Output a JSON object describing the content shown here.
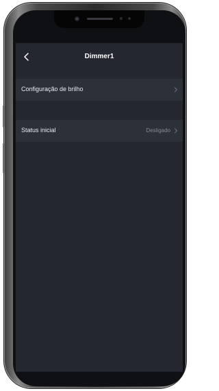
{
  "header": {
    "title": "Dimmer1",
    "back_icon": "chevron-left-icon"
  },
  "settings": {
    "brightness_label": "Configuração de brilho",
    "initial_status_label": "Status inicial",
    "initial_status_value": "Desligado",
    "chevron_icon": "chevron-right-icon"
  },
  "colors": {
    "screen_background": "#24272f",
    "row_background": "#2c3039",
    "primary_text": "#ffffff",
    "secondary_text": "#858a95"
  }
}
